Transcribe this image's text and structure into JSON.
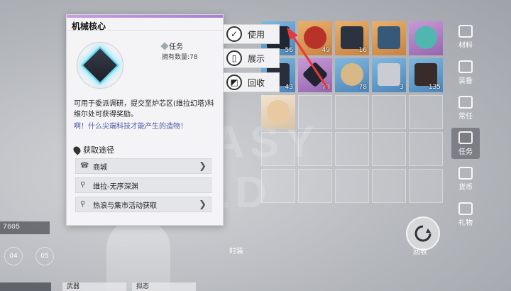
{
  "background": {
    "stat_value": "7605",
    "hex_labels": [
      "04",
      "05"
    ],
    "time_label": "时装",
    "caption": "",
    "bottom_tabs": [
      "",
      "武器",
      "拟态"
    ]
  },
  "item_panel": {
    "title": "机械核心",
    "type": "任务",
    "count_label": "拥有数量:78",
    "description": "可用于委派调研，提交至炉芯区(维拉幻塔)科维尔处可获得奖励。",
    "quote": "啊！什么尖端科技才能产生的造物！",
    "source_heading": "获取途径",
    "sources": [
      {
        "label": "商城",
        "has_arrow": true
      },
      {
        "label": "维拉-无序深渊",
        "has_arrow": false
      },
      {
        "label": "热浪与集市活动获取",
        "has_arrow": true
      }
    ],
    "accent_color": "#a680d0"
  },
  "action_menu": {
    "use": "使用",
    "show": "展示",
    "recycle": "回收"
  },
  "grid": {
    "slots": [
      {
        "color": "blue",
        "qty": "56"
      },
      {
        "color": "orange",
        "qty": "49"
      },
      {
        "color": "orange",
        "qty": "16"
      },
      {
        "color": "orange",
        "qty": ""
      },
      {
        "color": "purple",
        "qty": ""
      },
      {
        "color": "blue",
        "qty": "43"
      },
      {
        "color": "purple",
        "qty": "78"
      },
      {
        "color": "blue",
        "qty": "78"
      },
      {
        "color": "blue",
        "qty": "3"
      },
      {
        "color": "blue",
        "qty": "135"
      },
      {
        "color": "cream",
        "qty": ""
      }
    ]
  },
  "rail": {
    "items": [
      "材料",
      "装备",
      "常任",
      "任务",
      "货币",
      "礼物"
    ],
    "active_index": 3,
    "recycle_label": "回收"
  }
}
